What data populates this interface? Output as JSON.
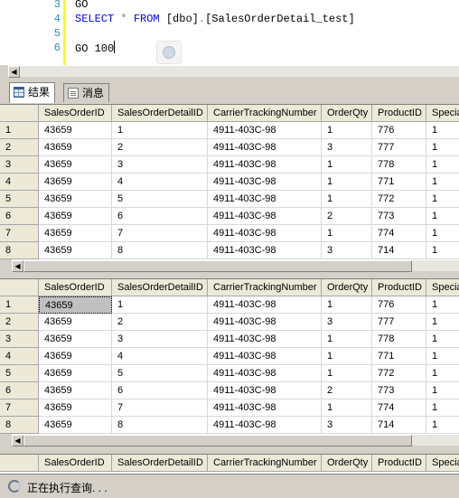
{
  "editor": {
    "lines": [
      {
        "num": "3",
        "parts": [
          {
            "t": "GO",
            "c": "plain"
          }
        ]
      },
      {
        "num": "4",
        "parts": [
          {
            "t": "SELECT",
            "c": "kw"
          },
          {
            "t": " ",
            "c": "plain"
          },
          {
            "t": "*",
            "c": "gr"
          },
          {
            "t": " ",
            "c": "plain"
          },
          {
            "t": "FROM",
            "c": "kw"
          },
          {
            "t": " [dbo]",
            "c": "plain"
          },
          {
            "t": ".",
            "c": "gr"
          },
          {
            "t": "[SalesOrderDetail_test]",
            "c": "plain"
          }
        ]
      },
      {
        "num": "5",
        "parts": []
      },
      {
        "num": "6",
        "parts": [
          {
            "t": "GO 100",
            "c": "plain"
          }
        ],
        "caret": true
      }
    ]
  },
  "tabs": [
    {
      "label": "结果",
      "icon": "grid-icon",
      "active": true
    },
    {
      "label": "消息",
      "icon": "message-icon",
      "active": false
    }
  ],
  "grid": {
    "columns": [
      "SalesOrderID",
      "SalesOrderDetailID",
      "CarrierTrackingNumber",
      "OrderQty",
      "ProductID",
      "Specia"
    ],
    "rows": [
      {
        "n": "1",
        "cells": [
          "43659",
          "1",
          "4911-403C-98",
          "1",
          "776",
          "1"
        ]
      },
      {
        "n": "2",
        "cells": [
          "43659",
          "2",
          "4911-403C-98",
          "3",
          "777",
          "1"
        ]
      },
      {
        "n": "3",
        "cells": [
          "43659",
          "3",
          "4911-403C-98",
          "1",
          "778",
          "1"
        ]
      },
      {
        "n": "4",
        "cells": [
          "43659",
          "4",
          "4911-403C-98",
          "1",
          "771",
          "1"
        ]
      },
      {
        "n": "5",
        "cells": [
          "43659",
          "5",
          "4911-403C-98",
          "1",
          "772",
          "1"
        ]
      },
      {
        "n": "6",
        "cells": [
          "43659",
          "6",
          "4911-403C-98",
          "2",
          "773",
          "1"
        ]
      },
      {
        "n": "7",
        "cells": [
          "43659",
          "7",
          "4911-403C-98",
          "1",
          "774",
          "1"
        ]
      },
      {
        "n": "8",
        "cells": [
          "43659",
          "8",
          "4911-403C-98",
          "3",
          "714",
          "1"
        ]
      }
    ]
  },
  "status": {
    "text": "正在执行查询. . ."
  },
  "colors": {
    "keyword": "#0000ff",
    "line_number": "#2b91af",
    "change_bar": "#ffff00"
  }
}
